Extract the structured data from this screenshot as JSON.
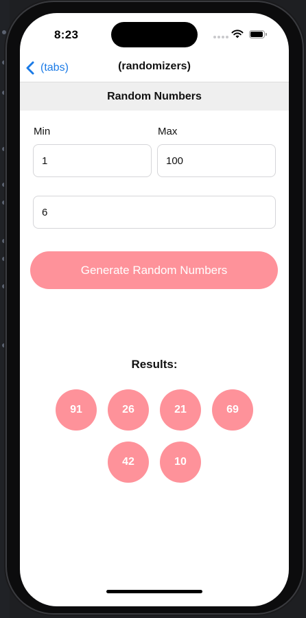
{
  "status_bar": {
    "time": "8:23",
    "icons": [
      "cell-signal-icon",
      "wifi-icon",
      "battery-icon"
    ]
  },
  "nav": {
    "back_label": "(tabs)",
    "back_icon": "chevron-left-icon",
    "title": "(randomizers)"
  },
  "section": {
    "title": "Random Numbers"
  },
  "form": {
    "min_label": "Min",
    "min_value": "1",
    "max_label": "Max",
    "max_value": "100",
    "count_value": "6",
    "generate_label": "Generate Random Numbers"
  },
  "results": {
    "title": "Results:",
    "numbers": [
      "91",
      "26",
      "21",
      "69",
      "42",
      "10"
    ]
  },
  "colors": {
    "accent": "#fe929a",
    "link": "#1a7ae6",
    "header_bg": "#efefef"
  }
}
